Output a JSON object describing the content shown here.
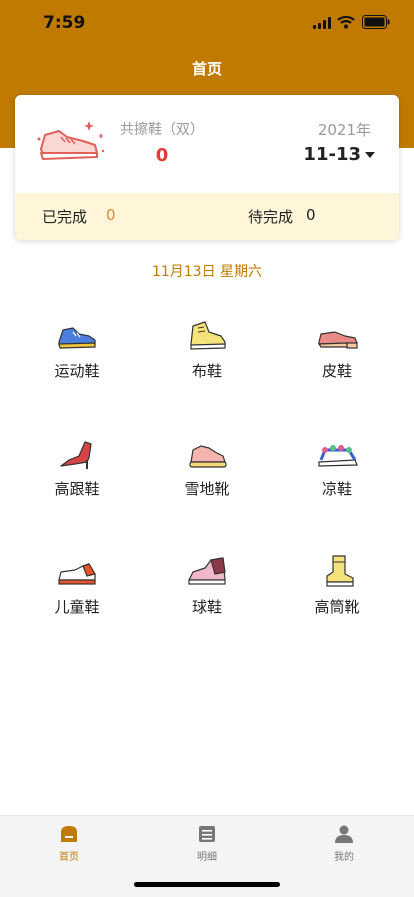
{
  "status_bar": {
    "time": "7:59",
    "signal_icon": "signal-icon",
    "wifi_icon": "wifi-icon",
    "battery_icon": "battery-icon"
  },
  "header": {
    "title": "首页",
    "background": "#c07a00"
  },
  "summary": {
    "icon": "sneaker-sparkle-icon",
    "total_label": "共擦鞋（双）",
    "total_value": "0",
    "year": "2021年",
    "date": "11-13",
    "completed_label": "已完成",
    "completed_value": "0",
    "pending_label": "待完成",
    "pending_value": "0"
  },
  "current_day": "11月13日 星期六",
  "categories": [
    {
      "label": "运动鞋",
      "icon": "sneaker-icon"
    },
    {
      "label": "布鞋",
      "icon": "canvas-shoe-icon"
    },
    {
      "label": "皮鞋",
      "icon": "leather-shoe-icon"
    },
    {
      "label": "高跟鞋",
      "icon": "high-heel-icon"
    },
    {
      "label": "雪地靴",
      "icon": "snow-boot-icon"
    },
    {
      "label": "凉鞋",
      "icon": "sandal-icon"
    },
    {
      "label": "儿童鞋",
      "icon": "kids-shoe-icon"
    },
    {
      "label": "球鞋",
      "icon": "basketball-shoe-icon"
    },
    {
      "label": "高筒靴",
      "icon": "tall-boot-icon"
    }
  ],
  "tabs": [
    {
      "label": "首页",
      "icon": "home-icon",
      "active": true
    },
    {
      "label": "明细",
      "icon": "list-icon",
      "active": false
    },
    {
      "label": "我的",
      "icon": "user-icon",
      "active": false
    }
  ],
  "colors": {
    "accent": "#c07a00",
    "highlight_red": "#e53935",
    "stats_bg": "#fff6d9"
  }
}
